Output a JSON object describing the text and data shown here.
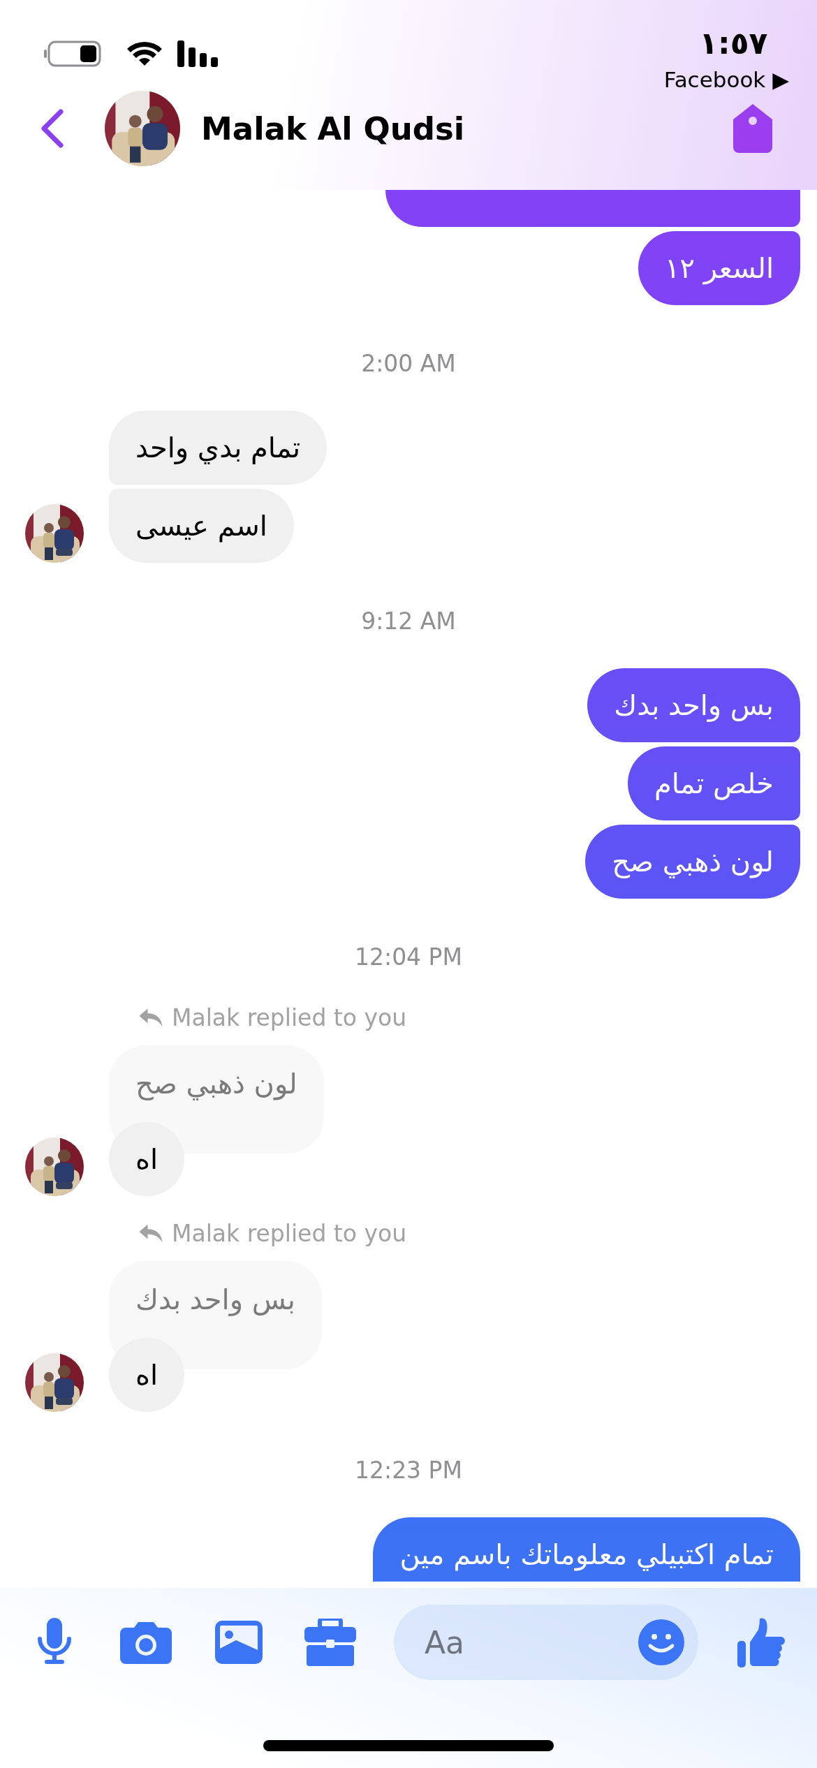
{
  "status_bar": {
    "time": "١:٥٧",
    "back_link": "Facebook ▶"
  },
  "header": {
    "name": "Malak Al Qudsi"
  },
  "messages": [
    {
      "kind": "outgoing",
      "clipped_above": true,
      "texts": [
        "السعر ١٢"
      ]
    },
    {
      "kind": "timestamp",
      "text": "2:00 AM"
    },
    {
      "kind": "incoming",
      "texts": [
        "تمام بدي واحد",
        "اسم عيسى"
      ]
    },
    {
      "kind": "timestamp",
      "text": "9:12 AM"
    },
    {
      "kind": "outgoing",
      "texts": [
        "بس واحد بدك",
        "خلص تمام",
        "لون ذهبي صح"
      ]
    },
    {
      "kind": "timestamp",
      "text": "12:04 PM"
    },
    {
      "kind": "reply",
      "label": "Malak replied to you",
      "quoted": "لون ذهبي صح",
      "text": "اه"
    },
    {
      "kind": "reply",
      "label": "Malak replied to you",
      "quoted": "بس واحد بدك",
      "text": "اه"
    },
    {
      "kind": "timestamp",
      "text": "12:23 PM"
    },
    {
      "kind": "outgoing",
      "texts": [
        "تمام اكتبيلي معلوماتك باسم مين"
      ]
    }
  ],
  "composer": {
    "placeholder": "Aa"
  }
}
